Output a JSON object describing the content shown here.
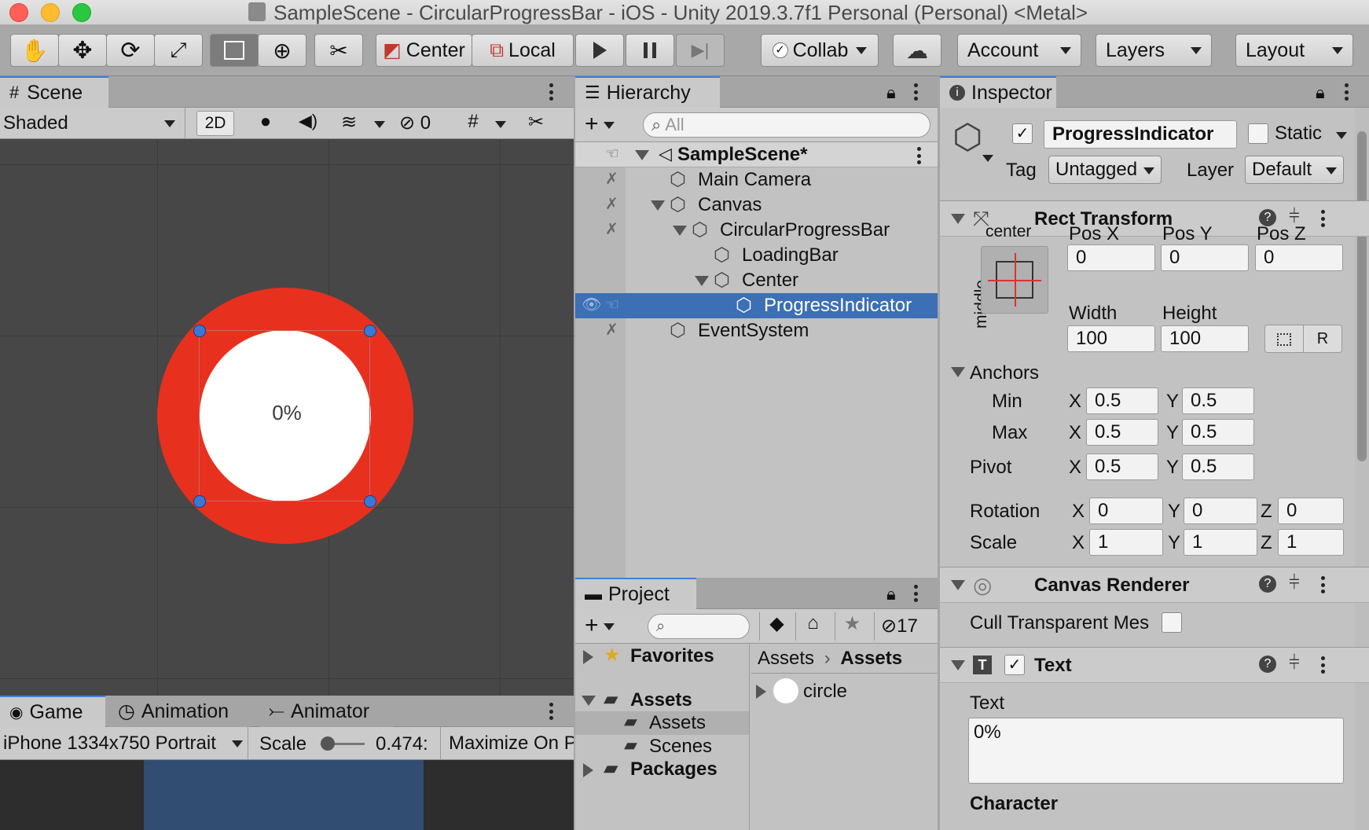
{
  "window": {
    "title": "SampleScene - CircularProgressBar - iOS - Unity 2019.3.7f1 Personal (Personal) <Metal>"
  },
  "toolbar": {
    "pivot_mode": "Center",
    "pivot_rotation": "Local",
    "collab": "Collab",
    "account": "Account",
    "layers": "Layers",
    "layout": "Layout"
  },
  "scene": {
    "tab": "Scene",
    "shading": "Shaded",
    "mode_2d": "2D",
    "hidden_count": "0",
    "progress_text": "0%",
    "colors": {
      "ring": "#e8301f",
      "inner": "#ffffff",
      "background": "#474747"
    }
  },
  "game": {
    "tabs": [
      "Game",
      "Animation",
      "Animator"
    ],
    "resolution": "iPhone 1334x750 Portrait",
    "scale_label": "Scale",
    "scale_value": "0.474:",
    "maximize": "Maximize On P"
  },
  "hierarchy": {
    "tab": "Hierarchy",
    "search_placeholder": "All",
    "items": [
      {
        "label": "SampleScene*"
      },
      {
        "label": "Main Camera"
      },
      {
        "label": "Canvas"
      },
      {
        "label": "CircularProgressBar"
      },
      {
        "label": "LoadingBar"
      },
      {
        "label": "Center"
      },
      {
        "label": "ProgressIndicator"
      },
      {
        "label": "EventSystem"
      }
    ]
  },
  "project": {
    "tab": "Project",
    "hidden_count": "17",
    "tree": {
      "favorites": "Favorites",
      "assets": "Assets",
      "assets_child": "Assets",
      "scenes": "Scenes",
      "packages": "Packages"
    },
    "breadcrumb": [
      "Assets",
      "Assets"
    ],
    "files": [
      {
        "name": "circle"
      }
    ]
  },
  "inspector": {
    "tab": "Inspector",
    "object_name": "ProgressIndicator",
    "static_label": "Static",
    "tag_label": "Tag",
    "tag_value": "Untagged",
    "layer_label": "Layer",
    "layer_value": "Default",
    "rect_transform": {
      "title": "Rect Transform",
      "anchor_h": "center",
      "anchor_v": "middle",
      "pos_x_label": "Pos X",
      "pos_y_label": "Pos Y",
      "pos_z_label": "Pos Z",
      "pos_x": "0",
      "pos_y": "0",
      "pos_z": "0",
      "width_label": "Width",
      "height_label": "Height",
      "width": "100",
      "height": "100",
      "r_button": "R",
      "anchors_label": "Anchors",
      "min_label": "Min",
      "max_label": "Max",
      "pivot_label": "Pivot",
      "x": "X",
      "y": "Y",
      "z": "Z",
      "min_x": "0.5",
      "min_y": "0.5",
      "max_x": "0.5",
      "max_y": "0.5",
      "pivot_x": "0.5",
      "pivot_y": "0.5",
      "rotation_label": "Rotation",
      "scale_label": "Scale",
      "rot_x": "0",
      "rot_y": "0",
      "rot_z": "0",
      "scale_x": "1",
      "scale_y": "1",
      "scale_z": "1"
    },
    "canvas_renderer": {
      "title": "Canvas Renderer",
      "cull_label": "Cull Transparent Mes"
    },
    "text": {
      "title": "Text",
      "text_label": "Text",
      "text_value": "0%",
      "character_label": "Character"
    }
  }
}
